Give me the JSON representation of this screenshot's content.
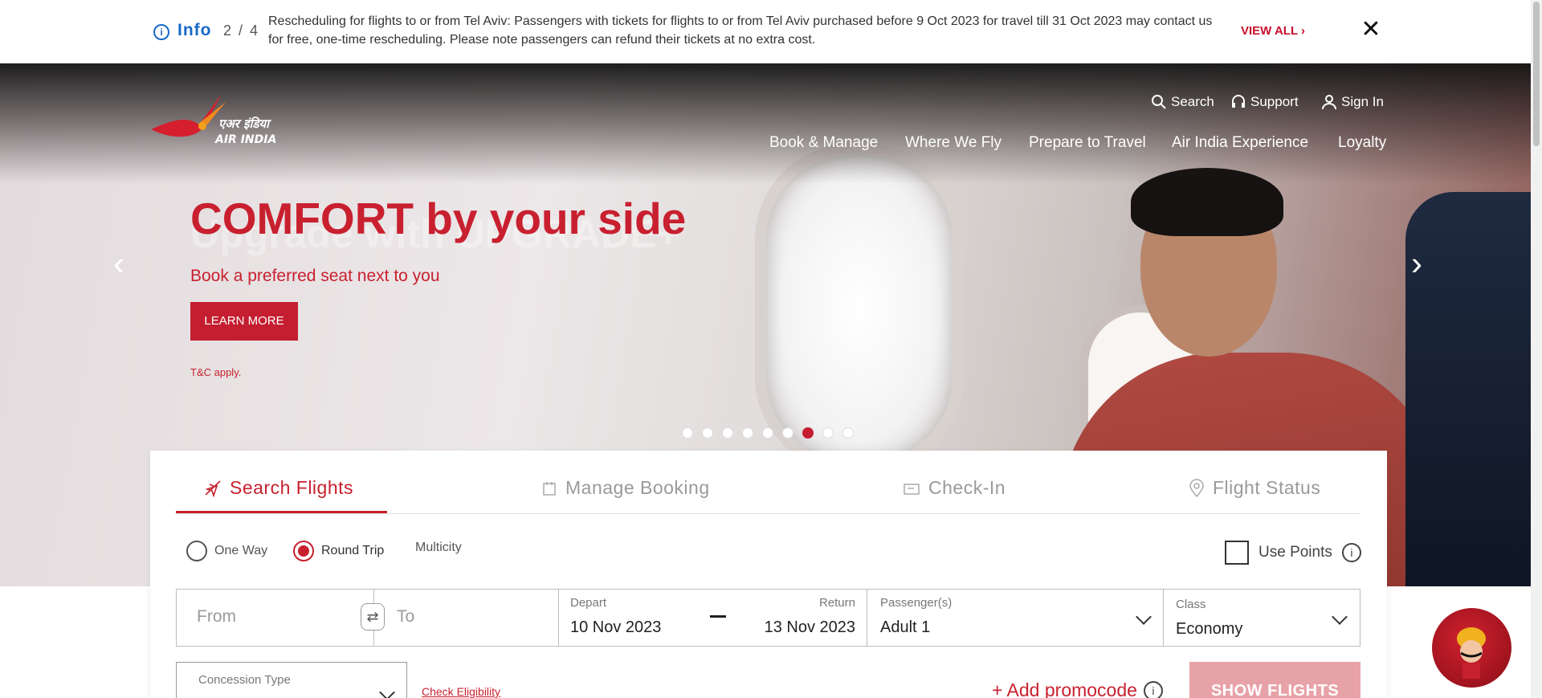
{
  "info_bar": {
    "label": "Info",
    "count": "2 / 4",
    "message": "Rescheduling for flights to or from Tel Aviv: Passengers with tickets for flights to or from Tel Aviv purchased before 9 Oct 2023 for travel till 31 Oct 2023 may contact us for free, one-time rescheduling. Please note passengers can refund their tickets at no extra cost.",
    "view_all": "VIEW ALL ›",
    "close": "✕"
  },
  "header": {
    "logo_hindi": "एअर इंडिया",
    "logo_text": "AIR INDIA",
    "utility": [
      {
        "label": "Search",
        "icon": "search-icon"
      },
      {
        "label": "Support",
        "icon": "headset-icon"
      },
      {
        "label": "Sign In",
        "icon": "user-icon"
      }
    ],
    "nav": [
      "Book & Manage",
      "Where We Fly",
      "Prepare to Travel",
      "Air India Experience",
      "Loyalty"
    ]
  },
  "hero": {
    "title": "COMFORT by your side",
    "ghost_title": "Upgrade with UPGRADE+",
    "subtitle": "Book a preferred seat next to you",
    "cta": "LEARN MORE",
    "tc": "T&C apply.",
    "prev": "‹",
    "next": "›",
    "slide_count": 9,
    "active_slide": 7
  },
  "booking": {
    "tabs": [
      {
        "label": "Search  Flights",
        "icon": "plane-icon",
        "active": true
      },
      {
        "label": "Manage  Booking",
        "icon": "calendar-icon",
        "active": false
      },
      {
        "label": "Check-In",
        "icon": "boarding-pass-icon",
        "active": false
      },
      {
        "label": "Flight  Status",
        "icon": "location-pin-icon",
        "active": false
      }
    ],
    "trip_types": [
      {
        "label": "One Way",
        "selected": false
      },
      {
        "label": "Round Trip",
        "selected": true
      },
      {
        "label": "Multicity",
        "selected": false
      }
    ],
    "use_points": "Use Points",
    "from_placeholder": "From",
    "to_placeholder": "To",
    "depart_label": "Depart",
    "depart_value": "10 Nov 2023",
    "return_label": "Return",
    "return_value": "13 Nov 2023",
    "passengers_label": "Passenger(s)",
    "passengers_value": "Adult 1",
    "class_label": "Class",
    "class_value": "Economy",
    "concession_label": "Concession Type",
    "check_eligibility": "Check Eligibility",
    "add_promocode": "+ Add promocode",
    "show_flights": "SHOW FLIGHTS"
  },
  "colors": {
    "brand_red": "#c8202f",
    "info_blue": "#1769c8",
    "button_disabled": "#e7a2a8"
  }
}
